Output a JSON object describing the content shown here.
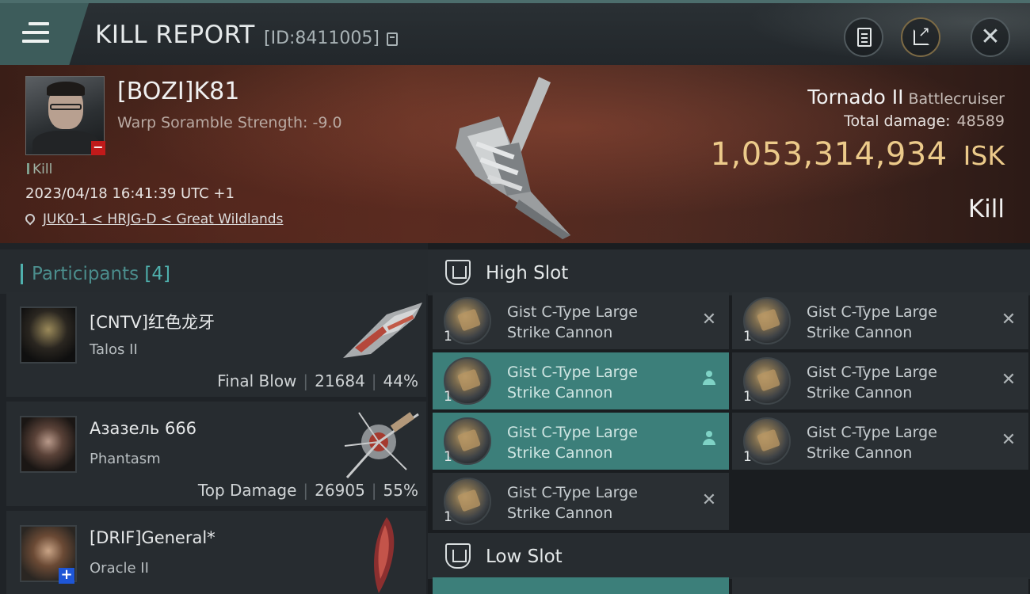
{
  "header": {
    "title": "KILL REPORT",
    "report_id": "[ID:8411005]",
    "icons": [
      "menu-icon",
      "copy-icon",
      "clipboard-icon",
      "share-icon",
      "close-icon"
    ]
  },
  "victim": {
    "name": "[BOZI]K81",
    "scramble": "Warp Soramble Strength: -9.0",
    "tag": "Kill",
    "timestamp": "2023/04/18 16:41:39 UTC +1",
    "location": "JUK0-1 < HRJG-D < Great Wildlands",
    "ship_name": "Tornado II",
    "ship_class": "Battlecruiser",
    "damage_label": "Total damage:",
    "damage_value": "48589",
    "isk_value": "1,053,314,934",
    "isk_unit": "ISK",
    "outcome": "Kill"
  },
  "participants": {
    "title": "Participants",
    "count": "[4]",
    "items": [
      {
        "name": "[CNTV]红色龙牙",
        "ship": "Talos II",
        "role": "Final Blow",
        "damage": "21684",
        "percent": "44%"
      },
      {
        "name": "Азазель 666",
        "ship": "Phantasm",
        "role": "Top Damage",
        "damage": "26905",
        "percent": "55%"
      },
      {
        "name": "[DRIF]General*",
        "ship": "Oracle II"
      }
    ]
  },
  "fitting": {
    "high_slot_title": "High Slot",
    "low_slot_title": "Low Slot",
    "high_modules": [
      {
        "name": "Gist C-Type Large Strike Cannon",
        "qty": "1",
        "state": "destroyed"
      },
      {
        "name": "Gist C-Type Large Strike Cannon",
        "qty": "1",
        "state": "destroyed"
      },
      {
        "name": "Gist C-Type Large Strike Cannon",
        "qty": "1",
        "state": "dropped"
      },
      {
        "name": "Gist C-Type Large Strike Cannon",
        "qty": "1",
        "state": "destroyed"
      },
      {
        "name": "Gist C-Type Large Strike Cannon",
        "qty": "1",
        "state": "dropped"
      },
      {
        "name": "Gist C-Type Large Strike Cannon",
        "qty": "1",
        "state": "destroyed"
      },
      {
        "name": "Gist C-Type Large Strike Cannon",
        "qty": "1",
        "state": "destroyed"
      }
    ],
    "status_glyphs": {
      "destroyed": "✕"
    }
  },
  "colors": {
    "accent_teal": "#4fb0ad",
    "isk_gold": "#ecca8a",
    "dropped_row": "#3c7f7a",
    "victim_banner": "#5a2e22"
  }
}
